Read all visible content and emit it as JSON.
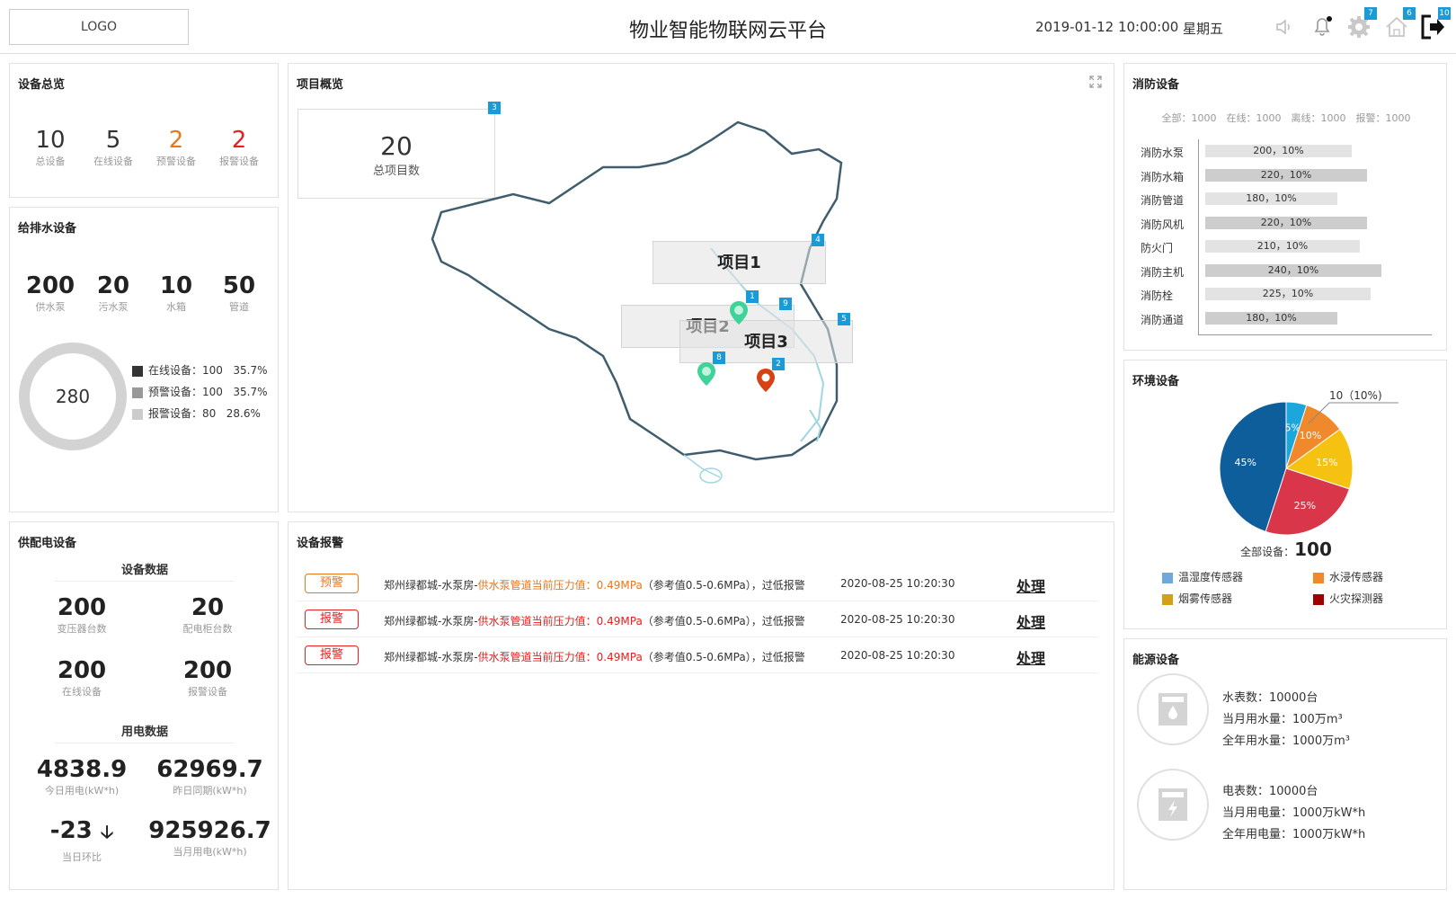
{
  "header": {
    "logo": "LOGO",
    "title": "物业智能物联网云平台",
    "datetime": "2019-01-12 10:00:00",
    "weekday": "星期五",
    "badges": {
      "settings": "7",
      "home": "6",
      "logout": "10"
    }
  },
  "device_overview": {
    "title": "设备总览",
    "stats": [
      {
        "value": "10",
        "label": "总设备",
        "color": "#333333"
      },
      {
        "value": "5",
        "label": "在线设备",
        "color": "#333333"
      },
      {
        "value": "2",
        "label": "预警设备",
        "color": "#e8771e"
      },
      {
        "value": "2",
        "label": "报警设备",
        "color": "#e5201f"
      }
    ]
  },
  "water": {
    "title": "给排水设备",
    "stats": [
      {
        "value": "200",
        "label": "供水泵"
      },
      {
        "value": "20",
        "label": "污水泵"
      },
      {
        "value": "10",
        "label": "水箱"
      },
      {
        "value": "50",
        "label": "管道"
      }
    ],
    "donut_total": "280",
    "legend": [
      {
        "label": "在线设备：",
        "count": "100",
        "pct": "35.7%",
        "color": "#333333"
      },
      {
        "label": "预警设备：",
        "count": "100",
        "pct": "35.7%",
        "color": "#999999"
      },
      {
        "label": "报警设备：",
        "count": "80",
        "pct": "28.6%",
        "color": "#cccccc"
      }
    ]
  },
  "power": {
    "title": "供配电设备",
    "section1": "设备数据",
    "section2": "用电数据",
    "device_stats": [
      {
        "value": "200",
        "label": "变压器台数"
      },
      {
        "value": "20",
        "label": "配电柜台数"
      },
      {
        "value": "200",
        "label": "在线设备"
      },
      {
        "value": "200",
        "label": "报警设备"
      }
    ],
    "usage_stats": [
      {
        "value": "4838.9",
        "label": "今日用电(kW*h)"
      },
      {
        "value": "62969.7",
        "label": "昨日同期(kW*h)"
      },
      {
        "value": "-23",
        "label": "当日环比"
      },
      {
        "value": "925926.7",
        "label": "当月用电(kW*h)"
      }
    ]
  },
  "project": {
    "title": "项目概览",
    "total_value": "20",
    "total_label": "总项目数",
    "total_badge": "3",
    "labels": [
      "项目1",
      "项目2",
      "项目3"
    ],
    "badges": {
      "b1": "1",
      "b2": "2",
      "b4": "4",
      "b5": "5",
      "b8": "8",
      "b9": "9"
    }
  },
  "alarms": {
    "title": "设备报警",
    "rows": [
      {
        "tag": "预警",
        "tag_color": "#e8771e",
        "loc": "郑州绿都城-水泵房-",
        "msg": "供水泵管道当前压力值：0.49MPa",
        "msg_color": "#e8771e",
        "ref": "（参考值0.5-0.6MPa），过低报警",
        "time": "2020-08-25 10:20:30",
        "action": "处理"
      },
      {
        "tag": "报警",
        "tag_color": "#e5201f",
        "loc": "郑州绿都城-水泵房-",
        "msg": "供水泵管道当前压力值：0.49MPa",
        "msg_color": "#e5201f",
        "ref": "（参考值0.5-0.6MPa），过低报警",
        "time": "2020-08-25 10:20:30",
        "action": "处理"
      },
      {
        "tag": "报警",
        "tag_color": "#e5201f",
        "loc": "郑州绿都城-水泵房-",
        "msg": "供水泵管道当前压力值：0.49MPa",
        "msg_color": "#e5201f",
        "ref": "（参考值0.5-0.6MPa），过低报警",
        "time": "2020-08-25 10:20:30",
        "action": "处理"
      }
    ]
  },
  "fire": {
    "title": "消防设备",
    "summary": "全部：1000　在线：1000　离线：1000　报警：1000",
    "rows": [
      {
        "label": "消防水泵",
        "text": "200，10%",
        "value": 200
      },
      {
        "label": "消防水箱",
        "text": "220，10%",
        "value": 220
      },
      {
        "label": "消防管道",
        "text": "180，10%",
        "value": 180
      },
      {
        "label": "消防风机",
        "text": "220，10%",
        "value": 220
      },
      {
        "label": "防火门",
        "text": "210，10%",
        "value": 210
      },
      {
        "label": "消防主机",
        "text": "240，10%",
        "value": 240
      },
      {
        "label": "消防栓",
        "text": "225，10%",
        "value": 225
      },
      {
        "label": "消防通道",
        "text": "180，10%",
        "value": 180
      }
    ]
  },
  "environment": {
    "title": "环境设备",
    "callout": "10（10%)",
    "total_label": "全部设备：",
    "total_value": "100",
    "chart_data": {
      "type": "pie",
      "slices": [
        {
          "label": "5%",
          "value": 5,
          "color": "#1ba7dc"
        },
        {
          "label": "10%",
          "value": 10,
          "color": "#f0892c"
        },
        {
          "label": "15%",
          "value": 15,
          "color": "#f5c211"
        },
        {
          "label": "25%",
          "value": 25,
          "color": "#d9364a"
        },
        {
          "label": "45%",
          "value": 45,
          "color": "#0f5e9c"
        }
      ]
    },
    "legend": [
      {
        "label": "温湿度传感器",
        "color": "#6fa8dc"
      },
      {
        "label": "水浸传感器",
        "color": "#f0892c"
      },
      {
        "label": "烟雾传感器",
        "color": "#d4a017"
      },
      {
        "label": "火灾探测器",
        "color": "#a00000"
      }
    ]
  },
  "energy": {
    "title": "能源设备",
    "water_lines": [
      "水表数：10000台",
      "当月用水量：100万m³",
      "全年用水量：1000万m³"
    ],
    "elec_lines": [
      "电表数：10000台",
      "当月用电量：1000万kW*h",
      "全年用电量：1000万kW*h"
    ]
  }
}
